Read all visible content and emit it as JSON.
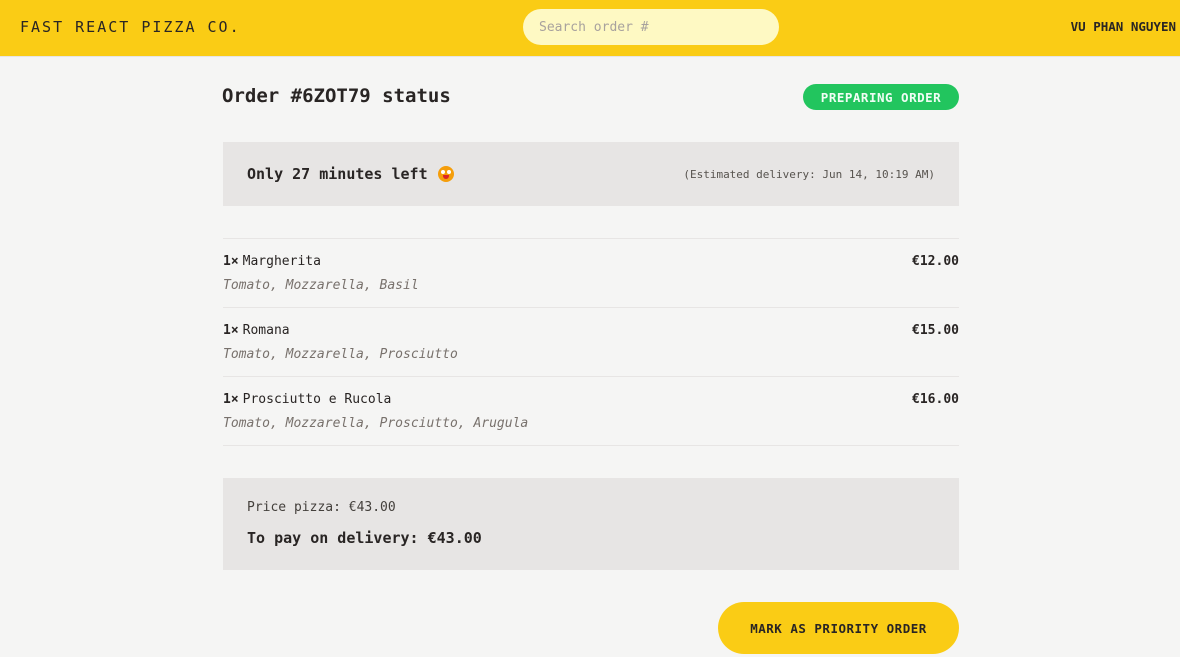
{
  "header": {
    "logo": "FAST REACT PIZZA CO.",
    "search_placeholder": "Search order #",
    "search_value": "",
    "username": "VU PHAN NGUYEN"
  },
  "order": {
    "title": "Order #6ZOT79 status",
    "status_badge": "PREPARING ORDER",
    "eta_main": "Only 27 minutes left",
    "eta_emoji_icon": "grinning-face-emoji-icon",
    "eta_sub": "(Estimated delivery: Jun 14, 10:19 AM)"
  },
  "items": [
    {
      "qty": "1×",
      "name": "Margherita",
      "price": "€12.00",
      "ingredients": "Tomato, Mozzarella, Basil"
    },
    {
      "qty": "1×",
      "name": "Romana",
      "price": "€15.00",
      "ingredients": "Tomato, Mozzarella, Prosciutto"
    },
    {
      "qty": "1×",
      "name": "Prosciutto e Rucola",
      "price": "€16.00",
      "ingredients": "Tomato, Mozzarella, Prosciutto, Arugula"
    }
  ],
  "summary": {
    "price_pizza": "Price pizza: €43.00",
    "to_pay": "To pay on delivery: €43.00"
  },
  "actions": {
    "priority_label": "MARK AS PRIORITY ORDER"
  },
  "colors": {
    "brand_yellow": "#facc15",
    "status_green": "#22c55e",
    "panel_gray": "#e7e5e4",
    "background": "#f5f5f4"
  }
}
